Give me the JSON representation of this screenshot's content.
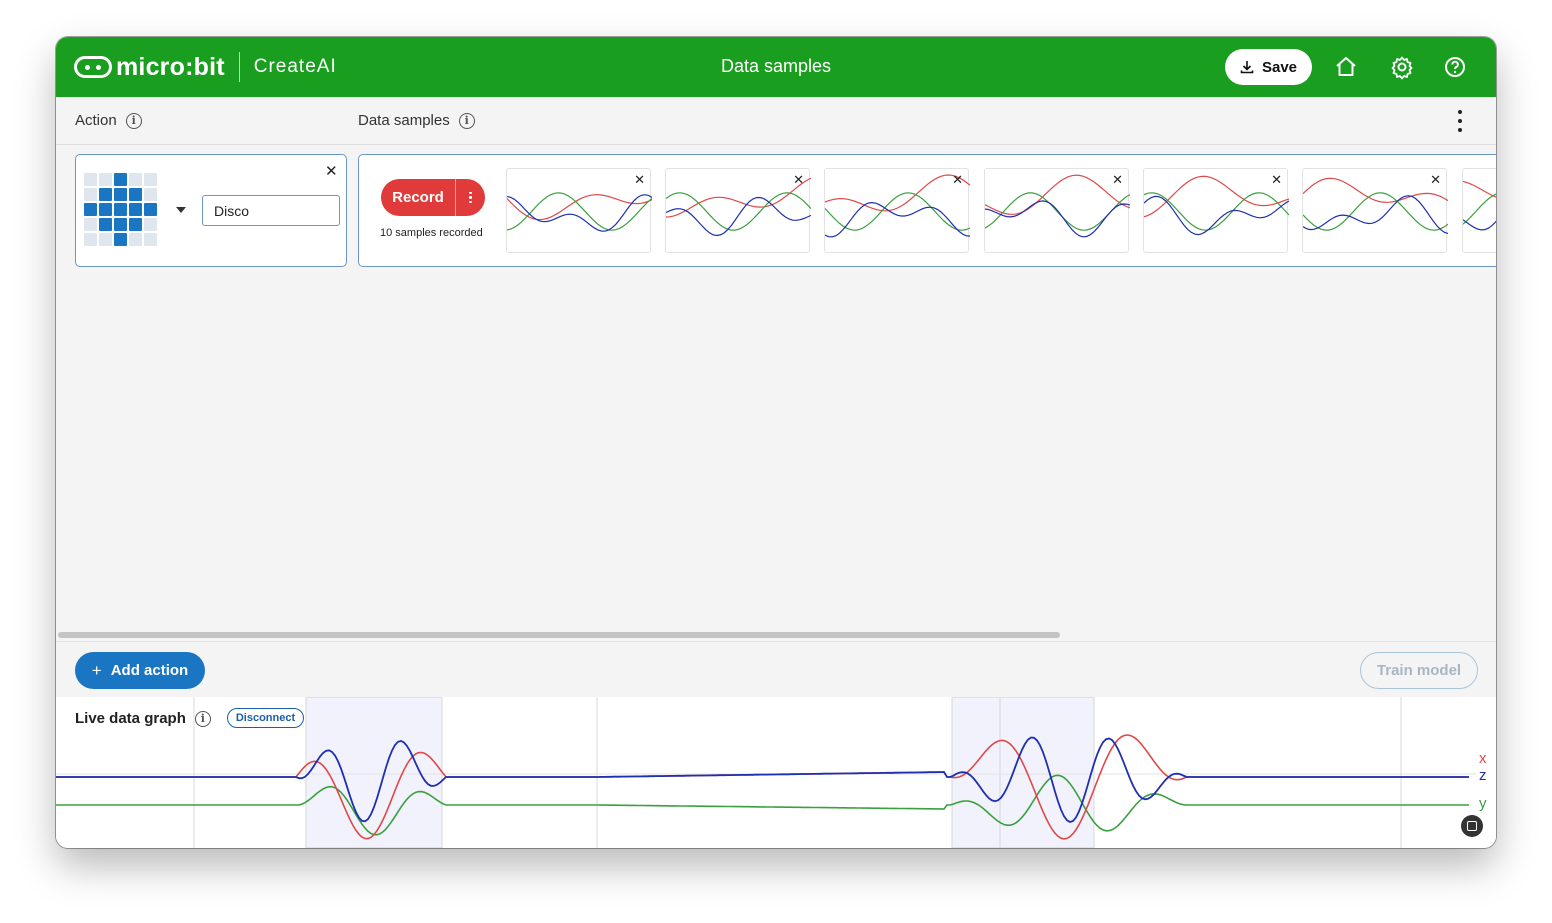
{
  "app": {
    "brand": "micro:bit",
    "product": "CreateAI",
    "page_title": "Data samples"
  },
  "topbar": {
    "save_label": "Save",
    "icons": [
      "download-icon",
      "home-icon",
      "gear-icon",
      "help-icon"
    ]
  },
  "columns": {
    "action_label": "Action",
    "data_samples_label": "Data samples"
  },
  "action": {
    "name_value": "Disco",
    "icon_grid": [
      [
        0,
        0,
        1,
        0,
        0
      ],
      [
        0,
        1,
        1,
        1,
        0
      ],
      [
        1,
        1,
        1,
        1,
        1
      ],
      [
        0,
        1,
        1,
        1,
        0
      ],
      [
        0,
        0,
        1,
        0,
        0
      ]
    ]
  },
  "samples": {
    "record_label": "Record",
    "count_text": "10 samples recorded"
  },
  "buttons": {
    "add_action": "Add action",
    "train_model": "Train model"
  },
  "live_graph": {
    "title": "Live data graph",
    "disconnect_label": "Disconnect",
    "axis_labels": {
      "x": "x",
      "z": "z",
      "y": "y"
    }
  },
  "colors": {
    "brand_green": "#1a9e1f",
    "primary_blue": "#1a75c2",
    "record_red": "#e03a3a",
    "x_red": "#e04848",
    "y_green": "#3aa03e",
    "z_blue": "#1f2fb0"
  }
}
